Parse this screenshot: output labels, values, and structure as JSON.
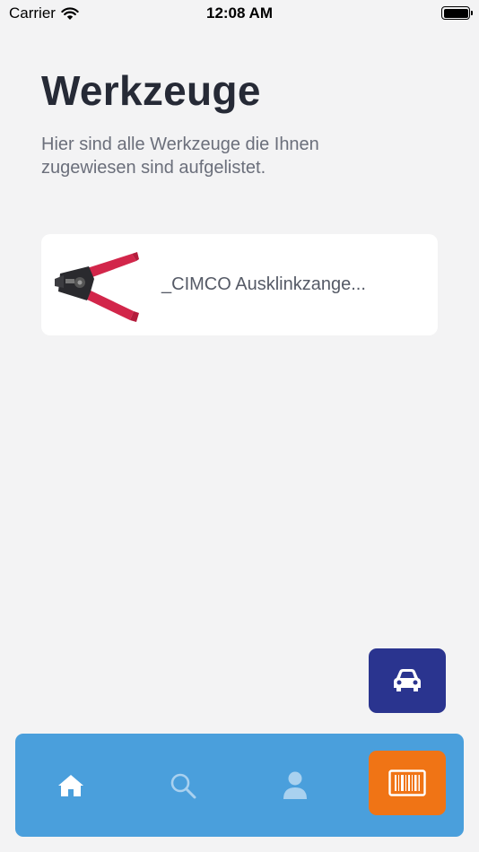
{
  "status_bar": {
    "carrier": "Carrier",
    "time": "12:08 AM",
    "icons": [
      "wifi-icon",
      "battery-icon"
    ]
  },
  "header": {
    "title": "Werkzeuge",
    "subtitle": "Hier sind alle Werkzeuge die Ihnen zugewiesen sind aufgelistet."
  },
  "tools": [
    {
      "name": "_CIMCO Ausklinkzange...",
      "image": "crimping-pliers-image"
    }
  ],
  "fab": {
    "icon": "car-icon",
    "color": "#2a348f"
  },
  "tab_bar": {
    "color": "#4a9fdc",
    "tabs": [
      {
        "id": "home",
        "icon": "home-icon",
        "active": true
      },
      {
        "id": "search",
        "icon": "search-icon",
        "active": false
      },
      {
        "id": "profile",
        "icon": "user-icon",
        "active": false
      },
      {
        "id": "scan",
        "icon": "barcode-icon",
        "active": false,
        "color": "#f07415"
      }
    ]
  }
}
